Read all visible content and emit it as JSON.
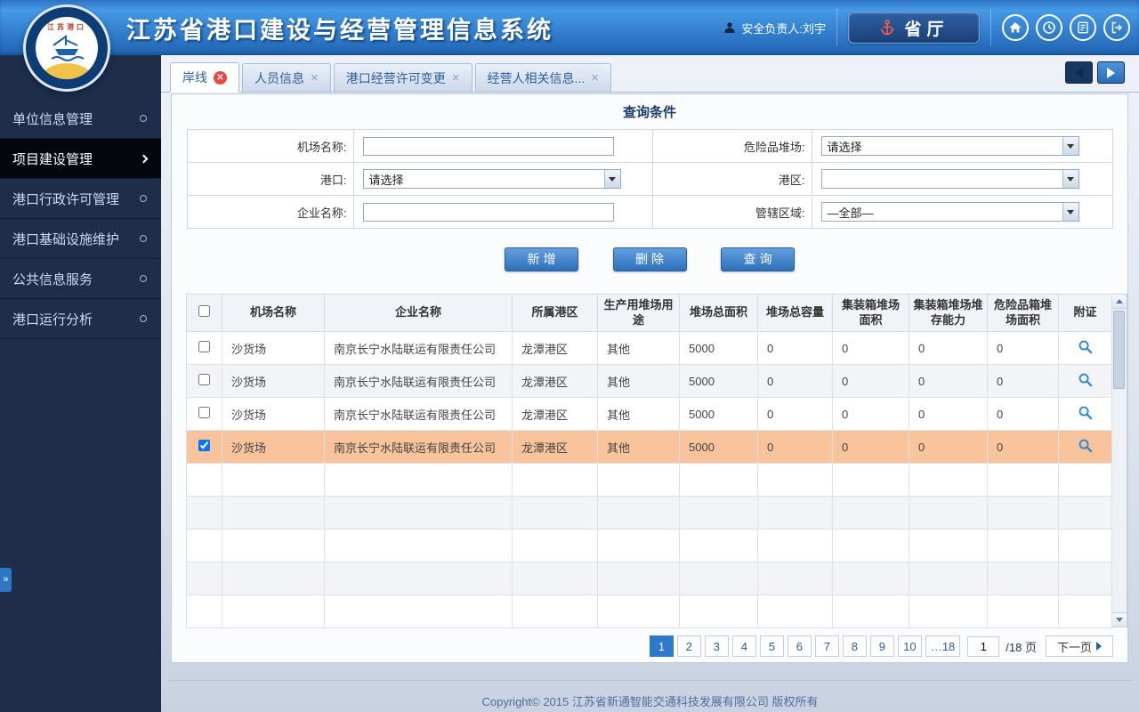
{
  "colors": {
    "accent": "#2e77c6",
    "header_gradient_top": "#459ae6",
    "sidebar_bg": "#1e2d4a",
    "selected_row": "#f9c49c",
    "tab_close_badge": "#e8483e"
  },
  "header": {
    "title": "江苏省港口建设与经营管理信息系统",
    "logo_text": "江苏港口",
    "user_label": "安全负责人:刘宇",
    "org_button_label": "省厅",
    "icons": [
      "home",
      "clock",
      "notepad",
      "logout"
    ]
  },
  "sidebar": {
    "active_index": 1,
    "items": [
      {
        "label": "单位信息管理"
      },
      {
        "label": "项目建设管理"
      },
      {
        "label": "港口行政许可管理"
      },
      {
        "label": "港口基础设施维护"
      },
      {
        "label": "公共信息服务"
      },
      {
        "label": "港口运行分析"
      }
    ]
  },
  "tabs": [
    {
      "label": "岸线",
      "active": true
    },
    {
      "label": "人员信息",
      "active": false
    },
    {
      "label": "港口经营许可变更",
      "active": false
    },
    {
      "label": "经营人相关信息...",
      "active": false
    }
  ],
  "query": {
    "title": "查询条件",
    "fields": [
      {
        "label": "机场名称:",
        "type": "text",
        "value": ""
      },
      {
        "label": "危险品堆场:",
        "type": "select",
        "value": "请选择"
      },
      {
        "label": "港口:",
        "type": "select",
        "value": "请选择"
      },
      {
        "label": "港区:",
        "type": "select",
        "value": ""
      },
      {
        "label": "企业名称:",
        "type": "text",
        "value": ""
      },
      {
        "label": "管辖区域:",
        "type": "select",
        "value": "—全部—"
      }
    ],
    "buttons": [
      {
        "label": "新增"
      },
      {
        "label": "删除"
      },
      {
        "label": "查询"
      }
    ]
  },
  "table": {
    "headers": [
      "机场名称",
      "企业名称",
      "所属港区",
      "生产用堆场用途",
      "堆场总面积",
      "堆场总容量",
      "集装箱堆场面积",
      "集装箱堆场堆存能力",
      "危险品箱堆场面积",
      "附证"
    ],
    "rows": [
      {
        "checked": false,
        "selected": false,
        "cells": [
          "沙货场",
          "南京长宁水陆联运有限责任公司",
          "龙潭港区",
          "其他",
          "5000",
          "0",
          "0",
          "0",
          "0"
        ]
      },
      {
        "checked": false,
        "selected": false,
        "cells": [
          "沙货场",
          "南京长宁水陆联运有限责任公司",
          "龙潭港区",
          "其他",
          "5000",
          "0",
          "0",
          "0",
          "0"
        ]
      },
      {
        "checked": false,
        "selected": false,
        "cells": [
          "沙货场",
          "南京长宁水陆联运有限责任公司",
          "龙潭港区",
          "其他",
          "5000",
          "0",
          "0",
          "0",
          "0"
        ]
      },
      {
        "checked": true,
        "selected": true,
        "cells": [
          "沙货场",
          "南京长宁水陆联运有限责任公司",
          "龙潭港区",
          "其他",
          "5000",
          "0",
          "0",
          "0",
          "0"
        ]
      }
    ],
    "empty_row_count": 5
  },
  "pagination": {
    "pages": [
      "1",
      "2",
      "3",
      "4",
      "5",
      "6",
      "7",
      "8",
      "9",
      "10",
      "…18"
    ],
    "active_page": "1",
    "page_input": "1",
    "total_label": "/18 页",
    "next_label": "下一页"
  },
  "footer": {
    "copyright": "Copyright© 2015 江苏省新通智能交通科技发展有限公司 版权所有"
  }
}
